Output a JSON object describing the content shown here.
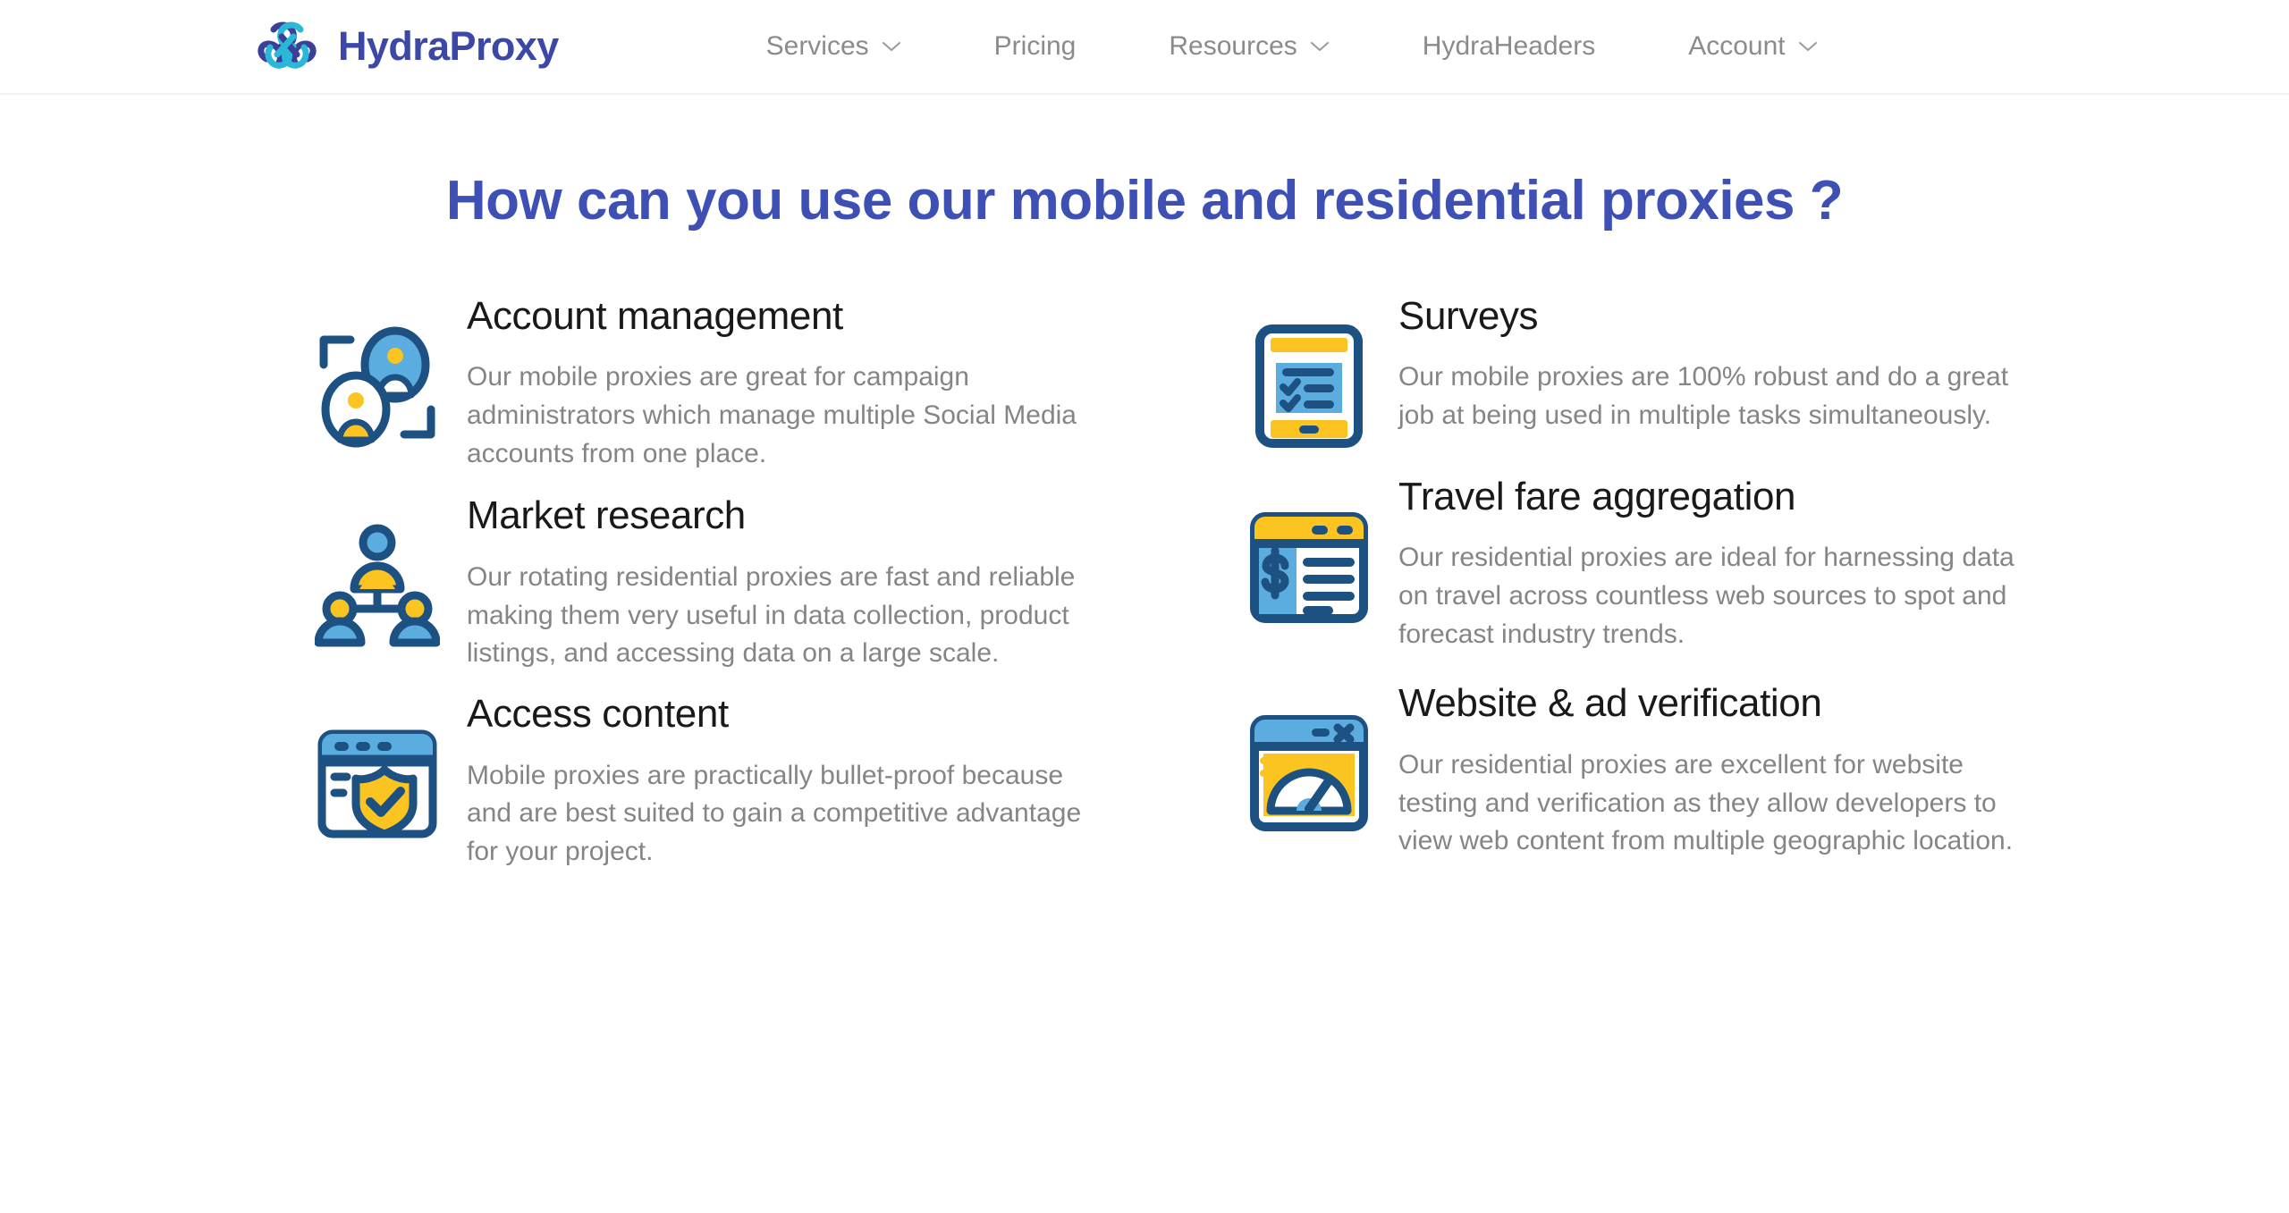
{
  "header": {
    "brand": {
      "name": "HydraProxy",
      "logo_icon": "hydra-knot-logo-icon"
    },
    "nav": [
      {
        "label": "Services",
        "has_dropdown": true
      },
      {
        "label": "Pricing",
        "has_dropdown": false
      },
      {
        "label": "Resources",
        "has_dropdown": true
      },
      {
        "label": "HydraHeaders",
        "has_dropdown": false
      },
      {
        "label": "Account",
        "has_dropdown": true
      }
    ]
  },
  "main": {
    "heading": "How can you use our mobile and residential proxies ?",
    "features_left": [
      {
        "icon": "two-users-framed-icon",
        "title": "Account management",
        "desc": "Our mobile proxies are great for campaign administrators which manage multiple Social Media accounts from one place."
      },
      {
        "icon": "org-chart-people-icon",
        "title": "Market research",
        "desc": "Our rotating residential proxies are fast and reliable making them very useful in data collection, product listings, and accessing data on a large scale."
      },
      {
        "icon": "browser-shield-check-icon",
        "title": "Access content",
        "desc": "Mobile proxies are practically bullet-proof because and are best suited to gain a competitive advantage for your project."
      }
    ],
    "features_right": [
      {
        "icon": "tablet-checklist-icon",
        "title": "Surveys",
        "desc": "Our mobile proxies are 100% robust and do a great job at being used in multiple tasks simultaneously."
      },
      {
        "icon": "browser-dollar-list-icon",
        "title": "Travel fare aggregation",
        "desc": "Our residential proxies are ideal for harnessing data on travel across countless web sources to spot and forecast industry trends."
      },
      {
        "icon": "browser-speedometer-icon",
        "title": "Website & ad verification",
        "desc": "Our residential proxies are excellent for website testing and verification as they allow developers to view web content from multiple geographic location."
      }
    ]
  },
  "colors": {
    "heading_blue": "#3f50b5",
    "brand_indigo": "#3b48a8",
    "logo_cyan": "#29b8d8",
    "icon_navy": "#1d5182",
    "icon_light_blue": "#5bacdf",
    "icon_yellow": "#fbc420",
    "nav_gray": "#8b8b8b",
    "body_gray": "#858585",
    "title_black": "#18191b"
  }
}
